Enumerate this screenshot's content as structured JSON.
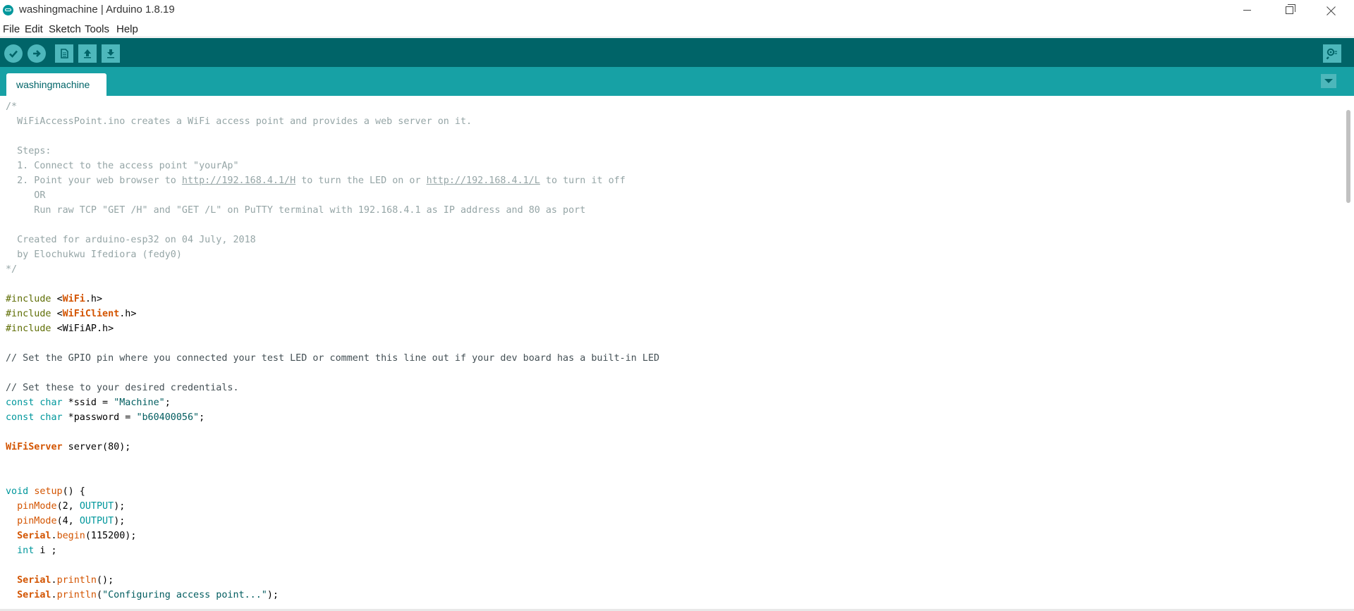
{
  "window": {
    "title": "washingmachine | Arduino 1.8.19",
    "icon": "arduino-logo-icon"
  },
  "menu": [
    "File",
    "Edit",
    "Sketch",
    "Tools",
    "Help"
  ],
  "toolbar": {
    "buttons": [
      "verify-icon",
      "upload-icon",
      "new-icon",
      "open-icon",
      "save-icon",
      "serial-monitor-icon"
    ]
  },
  "tabs": [
    {
      "label": "washingmachine"
    }
  ],
  "colors": {
    "toolbar": "#006468",
    "tabbar": "#17a1a5",
    "button": "#4db7bb"
  },
  "code": [
    [
      [
        "c",
        "/*"
      ]
    ],
    [
      [
        "c",
        "  WiFiAccessPoint.ino creates a WiFi access point and provides a web server on it."
      ]
    ],
    [],
    [
      [
        "c",
        "  Steps:"
      ]
    ],
    [
      [
        "c",
        "  1. Connect to the access point \"yourAp\""
      ]
    ],
    [
      [
        "c",
        "  2. Point your web browser to "
      ],
      [
        "u",
        "http://192.168.4.1/H"
      ],
      [
        "c",
        " to turn the LED on or "
      ],
      [
        "u",
        "http://192.168.4.1/L"
      ],
      [
        "c",
        " to turn it off"
      ]
    ],
    [
      [
        "c",
        "     OR"
      ]
    ],
    [
      [
        "c",
        "     Run raw TCP \"GET /H\" and \"GET /L\" on PuTTY terminal with 192.168.4.1 as IP address and 80 as port"
      ]
    ],
    [],
    [
      [
        "c",
        "  Created for arduino-esp32 on 04 July, 2018"
      ]
    ],
    [
      [
        "c",
        "  by Elochukwu Ifediora (fedy0)"
      ]
    ],
    [
      [
        "c",
        "*/"
      ]
    ],
    [],
    [
      [
        "p",
        "#include "
      ],
      [
        "t",
        "<"
      ],
      [
        "l",
        "WiFi"
      ],
      [
        "t",
        ".h>"
      ]
    ],
    [
      [
        "p",
        "#include "
      ],
      [
        "t",
        "<"
      ],
      [
        "l",
        "WiFiClient"
      ],
      [
        "t",
        ".h>"
      ]
    ],
    [
      [
        "p",
        "#include "
      ],
      [
        "t",
        "<WiFiAP.h>"
      ]
    ],
    [],
    [
      [
        "d",
        "// Set the GPIO pin where you connected your test LED or comment this line out if your dev board has a built-in LED"
      ]
    ],
    [],
    [
      [
        "d",
        "// Set these to your desired credentials."
      ]
    ],
    [
      [
        "k",
        "const"
      ],
      [
        "t",
        " "
      ],
      [
        "k",
        "char"
      ],
      [
        "t",
        " *ssid = "
      ],
      [
        "s",
        "\"Machine\""
      ],
      [
        "t",
        ";"
      ]
    ],
    [
      [
        "k",
        "const"
      ],
      [
        "t",
        " "
      ],
      [
        "k",
        "char"
      ],
      [
        "t",
        " *password = "
      ],
      [
        "s",
        "\"b60400056\""
      ],
      [
        "t",
        ";"
      ]
    ],
    [],
    [
      [
        "x",
        "WiFiServer"
      ],
      [
        "t",
        " server(80);"
      ]
    ],
    [],
    [],
    [
      [
        "k",
        "void"
      ],
      [
        "t",
        " "
      ],
      [
        "f",
        "setup"
      ],
      [
        "t",
        "() {"
      ]
    ],
    [
      [
        "t",
        "  "
      ],
      [
        "f",
        "pinMode"
      ],
      [
        "t",
        "(2, "
      ],
      [
        "k",
        "OUTPUT"
      ],
      [
        "t",
        ");"
      ]
    ],
    [
      [
        "t",
        "  "
      ],
      [
        "f",
        "pinMode"
      ],
      [
        "t",
        "(4, "
      ],
      [
        "k",
        "OUTPUT"
      ],
      [
        "t",
        ");"
      ]
    ],
    [
      [
        "t",
        "  "
      ],
      [
        "x",
        "Serial"
      ],
      [
        "t",
        "."
      ],
      [
        "f",
        "begin"
      ],
      [
        "t",
        "(115200);"
      ]
    ],
    [
      [
        "t",
        "  "
      ],
      [
        "k",
        "int"
      ],
      [
        "t",
        " i ;"
      ]
    ],
    [],
    [
      [
        "t",
        "  "
      ],
      [
        "x",
        "Serial"
      ],
      [
        "t",
        "."
      ],
      [
        "f",
        "println"
      ],
      [
        "t",
        "();"
      ]
    ],
    [
      [
        "t",
        "  "
      ],
      [
        "x",
        "Serial"
      ],
      [
        "t",
        "."
      ],
      [
        "f",
        "println"
      ],
      [
        "t",
        "("
      ],
      [
        "s",
        "\"Configuring access point...\""
      ],
      [
        "t",
        ");"
      ]
    ]
  ]
}
